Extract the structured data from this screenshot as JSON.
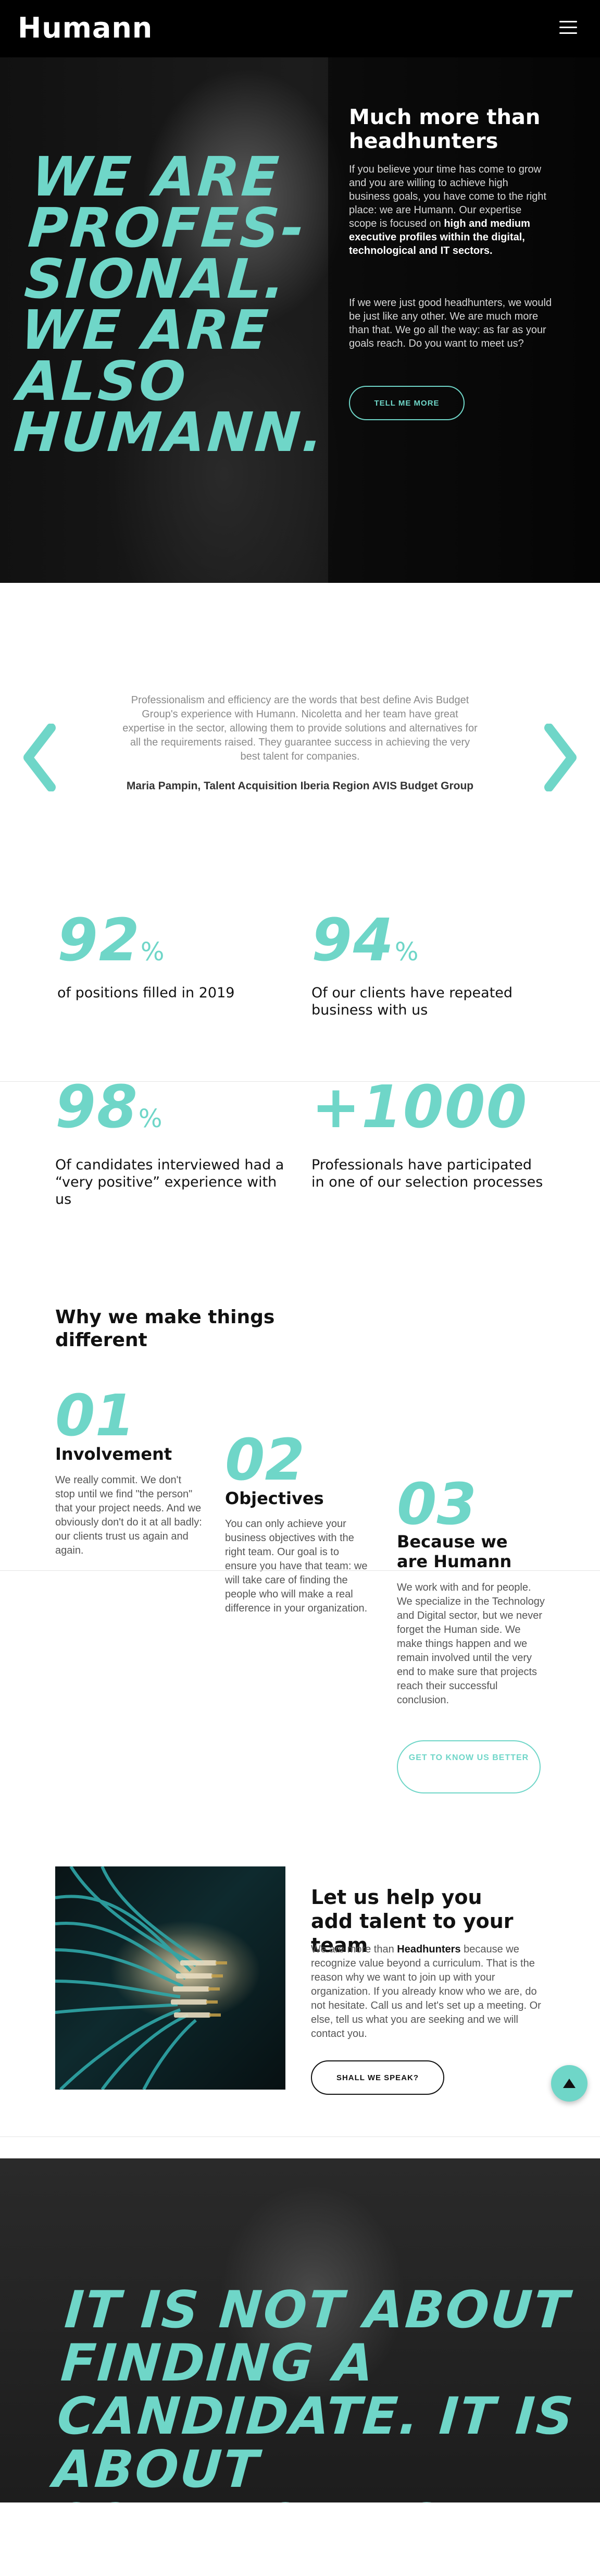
{
  "header": {
    "logo": "Humann",
    "menu_icon": "hamburger-icon"
  },
  "hero": {
    "headline": "WE ARE PROFES-\nSIONAL.\nWE ARE\nALSO\nHUMANN.",
    "title": "Much more than headhunters",
    "p1_a": "If you believe your time has come to grow and you are willing to achieve high business goals, you have come to the right place: we are Humann. Our expertise scope is focused on ",
    "p1_bold": "high and medium executive profiles within the digital, technological and IT sectors.",
    "p2": "If we were just good headhunters, we would be just like any other. We are much more than that. We go all the way: as far as your goals reach. Do you want to meet us?",
    "cta": "TELL ME MORE"
  },
  "testimonial": {
    "quote": "Professionalism and efficiency are the words that best define Avis Budget Group's experience with Humann. Nicoletta and her team have great expertise in the sector, allowing them to provide solutions and alternatives for all the requirements raised. They guarantee success in achieving the very best talent for companies.",
    "author": "Maria Pampin, Talent Acquisition Iberia Region AVIS Budget Group",
    "prev_icon": "chevron-left-icon",
    "next_icon": "chevron-right-icon"
  },
  "stats": [
    {
      "num": "92",
      "unit": "%",
      "label": "of positions filled in 2019"
    },
    {
      "num": "94",
      "unit": "%",
      "label": "Of our clients have repeated business with us"
    },
    {
      "num": "98",
      "unit": "%",
      "label": "Of candidates interviewed had a “very positive” experience with us"
    },
    {
      "num": "+1000",
      "unit": "",
      "label": "Professionals have participated in one of our selection processes"
    }
  ],
  "why": {
    "title": "Why we make things different",
    "items": [
      {
        "num": "01",
        "head": "Involvement",
        "text": "We really commit. We don't stop until we find \"the person\" that your project needs. And we obviously don't do it at all badly: our clients trust us again and again."
      },
      {
        "num": "02",
        "head": "Objectives",
        "text": "You can only achieve your business objectives with the right team. Our goal is to ensure you have that team: we will take care of finding the people who will make a real difference in your organization."
      },
      {
        "num": "03",
        "head": "Because we are Humann",
        "text": "We work with and for people. We specialize in the Technology and Digital sector, but we never forget the Human side. We make things happen and we remain involved until the very end to make sure that projects reach their successful conclusion."
      }
    ],
    "cta": "GET TO KNOW US BETTER"
  },
  "help": {
    "title": "Let us help you add talent to your team",
    "text_a": "We are more than ",
    "text_bold": "Headhunters",
    "text_b": " because we recognize value beyond a curriculum. That is the reason why we want to join up with your organization. If you already know who we are, do not hesitate. Call us and let's set up a meeting. Or else, tell us what you are seeking and we will contact you.",
    "cta": "SHALL WE SPEAK?"
  },
  "scroll_top_icon": "arrow-up-icon",
  "bottom": {
    "text": "IT IS NOT ABOUT FINDING A CANDIDATE. IT IS ABOUT CONNECTING."
  },
  "colors": {
    "accent": "#6fd6c8",
    "dark": "#000000"
  }
}
